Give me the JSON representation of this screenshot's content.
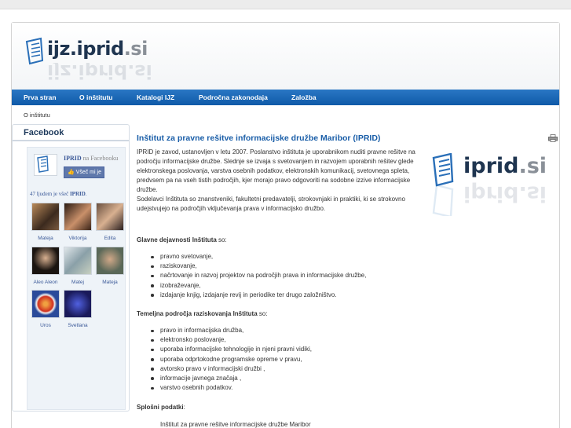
{
  "site": {
    "logo_main": "ijz.iprid",
    "logo_tld": ".si"
  },
  "nav": {
    "items": [
      "Prva stran",
      "O inštitutu",
      "Katalogi IJZ",
      "Področna zakonodaja",
      "Založba"
    ]
  },
  "breadcrumb": "O inštitutu",
  "sidebar": {
    "title": "Facebook",
    "fb_page_name": "IPRID",
    "fb_page_suffix": "na Facebooku",
    "like_label": "Všeč mi je",
    "likes_prefix": "47 ljudem je všeč",
    "likes_page": "IPRID",
    "likes_suffix": ".",
    "fans": [
      {
        "name": "Mateja"
      },
      {
        "name": "Viktorija"
      },
      {
        "name": "Edita"
      },
      {
        "name": "Aleo Aleon"
      },
      {
        "name": "Matej"
      },
      {
        "name": "Mateja"
      },
      {
        "name": "Uros"
      },
      {
        "name": "Svetlana"
      }
    ]
  },
  "article": {
    "title": "Inštitut za pravne rešitve informacijske družbe Maribor (IPRID)",
    "para1": "IPRID je zavod, ustanovljen v letu 2007. Poslanstvo inštituta je uporabnikom nuditi pravne rešitve na področju informacijske družbe. Slednje se izvaja s svetovanjem in razvojem uporabnih rešitev glede elektronskega poslovanja, varstva osebnih podatkov, elektronskih komunikacij, svetovnega spleta, predvsem pa na vseh tistih področjih, kjer morajo pravo odgovoriti na sodobne izzive informacijske družbe.",
    "para2": "Sodelavci Inštituta so znanstveniki, fakultetni predavatelji, strokovnjaki in praktiki, ki se strokovno udejstvujejo na področjih vključevanja prava v informacijsko družbo.",
    "side_logo_main": "iprid",
    "side_logo_tld": ".si",
    "activities_head": "Glavne dejavnosti Inštituta",
    "activities_tail": " so:",
    "activities": [
      "pravno svetovanje,",
      "raziskovanje,",
      "načrtovanje in razvoj projektov na področjih prava in informacijske družbe,",
      "izobraževanje,",
      "izdajanje knjig, izdajanje revij in periodike ter drugo založništvo."
    ],
    "research_head": "Temeljna področja raziskovanja Inštituta",
    "research_tail": " so:",
    "research": [
      "pravo in informacijska družba,",
      "elektronsko poslovanje,",
      "uporaba informacijske tehnologije in njeni pravni vidiki,",
      "uporaba odprtokodne programske opreme v pravu,",
      "avtorsko pravo v informacijski družbi ,",
      "informacije javnega značaja ,",
      "varstvo osebnih podatkov."
    ],
    "general_head": "Splošni podatki",
    "general_tail": ":",
    "address_line": "Inštitut za pravne rešitve informacijske družbe Maribor"
  }
}
